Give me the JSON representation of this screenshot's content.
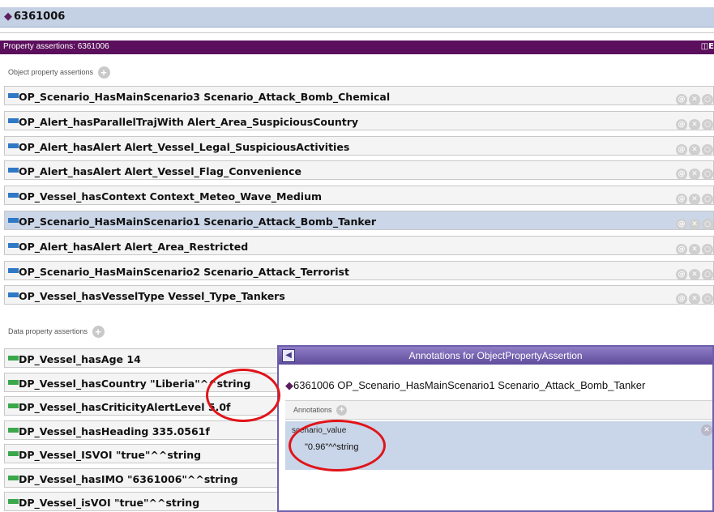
{
  "individual": {
    "name": "6361006"
  },
  "property_assertions": {
    "title": "Property assertions: 6361006",
    "view_icon": "◫E"
  },
  "object_section": {
    "label": "Object property assertions"
  },
  "object_assertions": [
    {
      "text": "OP_Scenario_HasMainScenario3  Scenario_Attack_Bomb_Chemical"
    },
    {
      "text": "OP_Alert_hasParallelTrajWith  Alert_Area_SuspiciousCountry"
    },
    {
      "text": "OP_Alert_hasAlert  Alert_Vessel_Legal_SuspiciousActivities"
    },
    {
      "text": "OP_Alert_hasAlert  Alert_Vessel_Flag_Convenience"
    },
    {
      "text": "OP_Vessel_hasContext  Context_Meteo_Wave_Medium"
    },
    {
      "text": "OP_Scenario_HasMainScenario1  Scenario_Attack_Bomb_Tanker"
    },
    {
      "text": "OP_Alert_hasAlert  Alert_Area_Restricted"
    },
    {
      "text": "OP_Scenario_HasMainScenario2  Scenario_Attack_Terrorist"
    },
    {
      "text": "OP_Vessel_hasVesselType  Vessel_Type_Tankers"
    }
  ],
  "data_section": {
    "label": "Data property assertions"
  },
  "data_assertions": [
    {
      "text": "DP_Vessel_hasAge  14"
    },
    {
      "text": "DP_Vessel_hasCountry  \"Liberia\"^^string"
    },
    {
      "text": "DP_Vessel_hasCriticityAlertLevel  5.0f"
    },
    {
      "text": "DP_Vessel_hasHeading  335.0561f"
    },
    {
      "text": "DP_Vessel_ISVOI  \"true\"^^string"
    },
    {
      "text": "DP_Vessel_hasIMO  \"6361006\"^^string"
    },
    {
      "text": "DP_Vessel_isVOI  \"true\"^^string"
    }
  ],
  "dialog": {
    "title": "Annotations for ObjectPropertyAssertion",
    "subject": "6361006 OP_Scenario_HasMainScenario1 Scenario_Attack_Bomb_Tanker",
    "annotations_label": "Annotations",
    "annotation": {
      "property": "scenario_value",
      "value": "\"0.96\"^^string"
    }
  },
  "selected_object_row": 5,
  "colors": {
    "object_property": "#2f78c6",
    "data_property": "#3aa84a",
    "header": "#5b0f5c",
    "highlight": "#e0141a"
  }
}
